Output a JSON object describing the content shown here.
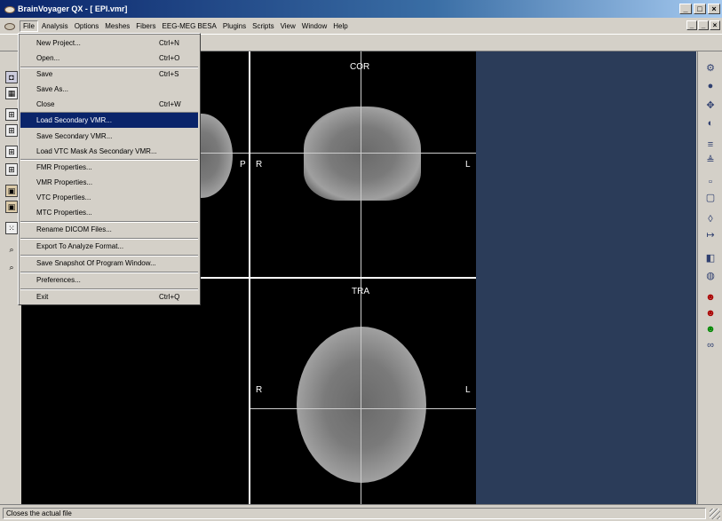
{
  "window": {
    "title": "BrainVoyager QX - [ EPI.vmr]",
    "min": "_",
    "max": "□",
    "close": "×"
  },
  "menubar": {
    "items": [
      "File",
      "Analysis",
      "Options",
      "Meshes",
      "Fibers",
      "EEG-MEG BESA",
      "Plugins",
      "Scripts",
      "View",
      "Window",
      "Help"
    ],
    "mdi": [
      "_",
      "̲",
      "×"
    ]
  },
  "file_menu": {
    "items": [
      {
        "label": "New Project...",
        "shortcut": "Ctrl+N"
      },
      {
        "label": "Open...",
        "shortcut": "Ctrl+O"
      },
      {
        "label": "Save",
        "shortcut": "Ctrl+S"
      },
      {
        "label": "Save As...",
        "shortcut": ""
      },
      {
        "label": "Close",
        "shortcut": "Ctrl+W"
      },
      {
        "label": "Load Secondary VMR...",
        "shortcut": "",
        "highlighted": true
      },
      {
        "label": "Save Secondary VMR...",
        "shortcut": ""
      },
      {
        "label": "Load VTC Mask As Secondary VMR...",
        "shortcut": ""
      },
      {
        "label": "FMR Properties...",
        "shortcut": ""
      },
      {
        "label": "VMR Properties...",
        "shortcut": ""
      },
      {
        "label": "VTC Properties...",
        "shortcut": ""
      },
      {
        "label": "MTC Properties...",
        "shortcut": ""
      },
      {
        "label": "Rename DICOM Files...",
        "shortcut": ""
      },
      {
        "label": "Export To Analyze Format...",
        "shortcut": ""
      },
      {
        "label": "Save Snapshot Of Program Window...",
        "shortcut": ""
      },
      {
        "label": "Preferences...",
        "shortcut": ""
      },
      {
        "label": "Exit",
        "shortcut": "Ctrl+Q"
      }
    ]
  },
  "viewer": {
    "sag": {
      "label_p": "P"
    },
    "cor": {
      "title": "COR",
      "label_r": "R",
      "label_l": "L"
    },
    "tra": {
      "title": "TRA",
      "label_r": "R",
      "label_l": "L"
    }
  },
  "status": {
    "text": "Closes the actual file"
  },
  "colors": {
    "title_start": "#0a246a",
    "title_end": "#a6caf0",
    "panel": "#2b3c59",
    "highlight": "#0a246a"
  }
}
